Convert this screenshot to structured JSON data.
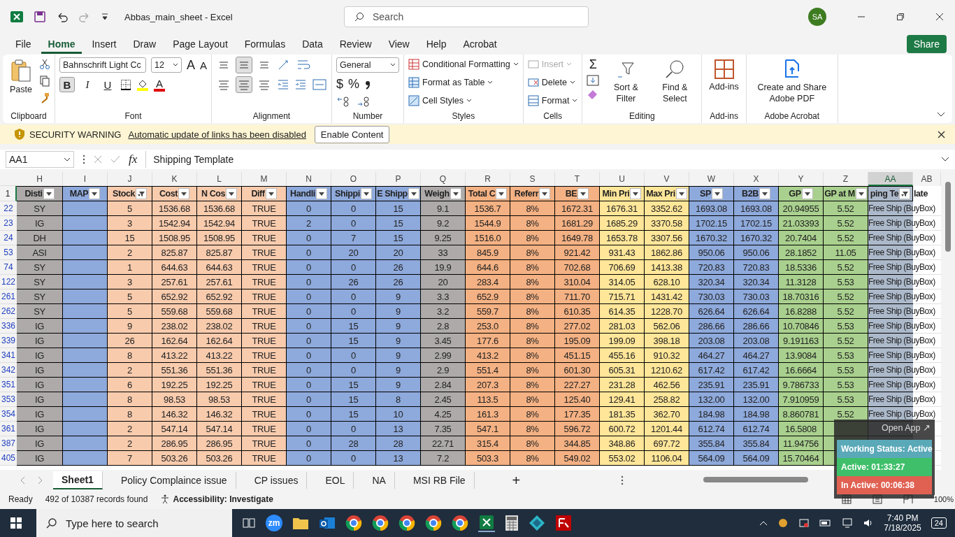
{
  "title_bar": {
    "title": "Abbas_main_sheet  -  Excel",
    "search_placeholder": "Search",
    "avatar": "SA"
  },
  "menu_tabs": [
    {
      "label": "File",
      "selected": false
    },
    {
      "label": "Home",
      "selected": true
    },
    {
      "label": "Insert",
      "selected": false
    },
    {
      "label": "Draw",
      "selected": false
    },
    {
      "label": "Page Layout",
      "selected": false
    },
    {
      "label": "Formulas",
      "selected": false
    },
    {
      "label": "Data",
      "selected": false
    },
    {
      "label": "Review",
      "selected": false
    },
    {
      "label": "View",
      "selected": false
    },
    {
      "label": "Help",
      "selected": false
    },
    {
      "label": "Acrobat",
      "selected": false
    }
  ],
  "share_button": "Share",
  "ribbon": {
    "paste": "Paste",
    "clipboard": "Clipboard",
    "font_name": "Bahnschrift Light Cc",
    "font_size": "12",
    "grow": "A",
    "shrink": "A",
    "bold": {
      "label": "B",
      "selected": true
    },
    "italic": {
      "label": "I",
      "selected": false
    },
    "underline": {
      "label": "U",
      "selected": false
    },
    "font_color_glyph": "A",
    "font": "Font",
    "align_center_selected": true,
    "alignment": "Alignment",
    "number_format": "General",
    "currency": "$",
    "percent": "%",
    "number": "Number",
    "conditional_formatting": "Conditional Formatting",
    "format_as_table": "Format as Table",
    "cell_styles": "Cell Styles",
    "styles": "Styles",
    "insert": {
      "label": "Insert",
      "disabled": true
    },
    "delete": "Delete",
    "format": "Format",
    "cells": "Cells",
    "sum": "Σ",
    "sort_filter": "Sort & Filter",
    "find_select": "Find & Select",
    "editing": "Editing",
    "addins_button": "Add-ins",
    "addins": "Add-ins",
    "create_pdf": "Create and Share Adobe PDF",
    "acrobat": "Adobe Acrobat"
  },
  "security_bar": {
    "title": "SECURITY WARNING",
    "message": "Automatic update of links has been disabled",
    "button": "Enable Content"
  },
  "formula_bar": {
    "name_box": "AA1",
    "fx": "fx",
    "formula": "Shipping Template"
  },
  "columns": [
    {
      "letter": "H",
      "header": "Disti",
      "color": "#aeaaaa",
      "filtered": false,
      "selected": false
    },
    {
      "letter": "I",
      "header": "MAP",
      "color": "#8ea9db",
      "filtered": false,
      "selected": false
    },
    {
      "letter": "J",
      "header": "Stock",
      "color": "#f8cbad",
      "filtered": true,
      "selected": false
    },
    {
      "letter": "K",
      "header": "Cost",
      "color": "#f8cbad",
      "filtered": false,
      "selected": false
    },
    {
      "letter": "L",
      "header": "N Cos",
      "color": "#f8cbad",
      "filtered": false,
      "selected": false
    },
    {
      "letter": "M",
      "header": "Diff",
      "color": "#f8cbad",
      "filtered": false,
      "selected": false
    },
    {
      "letter": "N",
      "header": "Handli",
      "color": "#8ea9db",
      "filtered": false,
      "selected": false
    },
    {
      "letter": "O",
      "header": "Shippi",
      "color": "#8ea9db",
      "filtered": false,
      "selected": false
    },
    {
      "letter": "P",
      "header": "E Shipp",
      "color": "#8ea9db",
      "filtered": false,
      "selected": false
    },
    {
      "letter": "Q",
      "header": "Weigh",
      "color": "#aeaaaa",
      "filtered": false,
      "selected": false
    },
    {
      "letter": "R",
      "header": "Total C",
      "color": "#f4b183",
      "filtered": false,
      "selected": false
    },
    {
      "letter": "S",
      "header": "Referr",
      "color": "#f4b183",
      "filtered": false,
      "selected": false
    },
    {
      "letter": "T",
      "header": "BE",
      "color": "#f4b183",
      "filtered": false,
      "selected": false
    },
    {
      "letter": "U",
      "header": "Min Pri",
      "color": "#ffe699",
      "filtered": false,
      "selected": false
    },
    {
      "letter": "V",
      "header": "Max Pri",
      "color": "#ffe699",
      "filtered": false,
      "selected": false
    },
    {
      "letter": "W",
      "header": "SP",
      "color": "#8ea9db",
      "filtered": false,
      "selected": false
    },
    {
      "letter": "X",
      "header": "B2B",
      "color": "#8ea9db",
      "filtered": false,
      "selected": false
    },
    {
      "letter": "Y",
      "header": "GP",
      "color": "#a9d08e",
      "filtered": false,
      "selected": false
    },
    {
      "letter": "Z",
      "header": "GP at M",
      "color": "#a9d08e",
      "filtered": false,
      "selected": false
    },
    {
      "letter": "AA",
      "header": "ping Te",
      "color": "#acb9ca",
      "filtered": true,
      "selected": true
    },
    {
      "letter": "AB",
      "header": "late",
      "color": "#ffffff",
      "selected": false
    }
  ],
  "header_row": "1",
  "rows": [
    {
      "row": "22",
      "cells": [
        "SY",
        null,
        "5",
        "1536.68",
        "1536.68",
        "TRUE",
        "0",
        "0",
        "15",
        "9.1",
        "1536.7",
        "8%",
        "1672.31",
        "1676.31",
        "3352.62",
        "1693.08",
        "1693.08",
        "20.94955",
        "5.52",
        "Free Ship (BuyBox)"
      ]
    },
    {
      "row": "23",
      "cells": [
        "IG",
        null,
        "3",
        "1542.94",
        "1542.94",
        "TRUE",
        "2",
        "0",
        "15",
        "9.2",
        "1544.9",
        "8%",
        "1681.29",
        "1685.29",
        "3370.58",
        "1702.15",
        "1702.15",
        "21.03393",
        "5.52",
        "Free Ship (BuyBox)"
      ]
    },
    {
      "row": "24",
      "cells": [
        "DH",
        null,
        "15",
        "1508.95",
        "1508.95",
        "TRUE",
        "0",
        "7",
        "15",
        "9.25",
        "1516.0",
        "8%",
        "1649.78",
        "1653.78",
        "3307.56",
        "1670.32",
        "1670.32",
        "20.7404",
        "5.52",
        "Free Ship (BuyBox)"
      ]
    },
    {
      "row": "53",
      "cells": [
        "ASI",
        null,
        "2",
        "825.87",
        "825.87",
        "TRUE",
        "0",
        "20",
        "20",
        "33",
        "845.9",
        "8%",
        "921.42",
        "931.43",
        "1862.86",
        "950.06",
        "950.06",
        "28.1852",
        "11.05",
        "Free Ship (BuyBox)"
      ]
    },
    {
      "row": "74",
      "cells": [
        "SY",
        null,
        "1",
        "644.63",
        "644.63",
        "TRUE",
        "0",
        "0",
        "26",
        "19.9",
        "644.6",
        "8%",
        "702.68",
        "706.69",
        "1413.38",
        "720.83",
        "720.83",
        "18.5336",
        "5.52",
        "Free Ship (BuyBox)"
      ]
    },
    {
      "row": "122",
      "cells": [
        "SY",
        null,
        "3",
        "257.61",
        "257.61",
        "TRUE",
        "0",
        "26",
        "26",
        "20",
        "283.4",
        "8%",
        "310.04",
        "314.05",
        "628.10",
        "320.34",
        "320.34",
        "11.3128",
        "5.53",
        "Free Ship (BuyBox)"
      ]
    },
    {
      "row": "261",
      "cells": [
        "SY",
        null,
        "5",
        "652.92",
        "652.92",
        "TRUE",
        "0",
        "0",
        "9",
        "3.3",
        "652.9",
        "8%",
        "711.70",
        "715.71",
        "1431.42",
        "730.03",
        "730.03",
        "18.70316",
        "5.52",
        "Free Ship (BuyBox)"
      ]
    },
    {
      "row": "262",
      "cells": [
        "SY",
        null,
        "5",
        "559.68",
        "559.68",
        "TRUE",
        "0",
        "0",
        "9",
        "3.2",
        "559.7",
        "8%",
        "610.35",
        "614.35",
        "1228.70",
        "626.64",
        "626.64",
        "16.8288",
        "5.52",
        "Free Ship (BuyBox)"
      ]
    },
    {
      "row": "336",
      "cells": [
        "IG",
        null,
        "9",
        "238.02",
        "238.02",
        "TRUE",
        "0",
        "15",
        "9",
        "2.8",
        "253.0",
        "8%",
        "277.02",
        "281.03",
        "562.06",
        "286.66",
        "286.66",
        "10.70846",
        "5.53",
        "Free Ship (BuyBox)"
      ]
    },
    {
      "row": "339",
      "cells": [
        "IG",
        null,
        "26",
        "162.64",
        "162.64",
        "TRUE",
        "0",
        "15",
        "9",
        "3.45",
        "177.6",
        "8%",
        "195.09",
        "199.09",
        "398.18",
        "203.08",
        "203.08",
        "9.191163",
        "5.52",
        "Free Ship (BuyBox)"
      ]
    },
    {
      "row": "341",
      "cells": [
        "IG",
        null,
        "8",
        "413.22",
        "413.22",
        "TRUE",
        "0",
        "0",
        "9",
        "2.99",
        "413.2",
        "8%",
        "451.15",
        "455.16",
        "910.32",
        "464.27",
        "464.27",
        "13.9084",
        "5.53",
        "Free Ship (BuyBox)"
      ]
    },
    {
      "row": "342",
      "cells": [
        "IG",
        null,
        "2",
        "551.36",
        "551.36",
        "TRUE",
        "0",
        "0",
        "9",
        "2.9",
        "551.4",
        "8%",
        "601.30",
        "605.31",
        "1210.62",
        "617.42",
        "617.42",
        "16.6664",
        "5.53",
        "Free Ship (BuyBox)"
      ]
    },
    {
      "row": "351",
      "cells": [
        "IG",
        null,
        "6",
        "192.25",
        "192.25",
        "TRUE",
        "0",
        "15",
        "9",
        "2.84",
        "207.3",
        "8%",
        "227.27",
        "231.28",
        "462.56",
        "235.91",
        "235.91",
        "9.786733",
        "5.53",
        "Free Ship (BuyBox)"
      ]
    },
    {
      "row": "353",
      "cells": [
        "IG",
        null,
        "8",
        "98.53",
        "98.53",
        "TRUE",
        "0",
        "15",
        "8",
        "2.45",
        "113.5",
        "8%",
        "125.40",
        "129.41",
        "258.82",
        "132.00",
        "132.00",
        "7.910959",
        "5.53",
        "Free Ship (BuyBox)"
      ]
    },
    {
      "row": "354",
      "cells": [
        "IG",
        null,
        "8",
        "146.32",
        "146.32",
        "TRUE",
        "0",
        "15",
        "10",
        "4.25",
        "161.3",
        "8%",
        "177.35",
        "181.35",
        "362.70",
        "184.98",
        "184.98",
        "8.860781",
        "5.52",
        "Free Ship (BuyBox)"
      ]
    },
    {
      "row": "361",
      "cells": [
        "IG",
        null,
        "2",
        "547.14",
        "547.14",
        "TRUE",
        "0",
        "0",
        "13",
        "7.35",
        "547.1",
        "8%",
        "596.72",
        "600.72",
        "1201.44",
        "612.74",
        "612.74",
        "16.5808",
        null,
        null
      ]
    },
    {
      "row": "387",
      "cells": [
        "IG",
        null,
        "2",
        "286.95",
        "286.95",
        "TRUE",
        "0",
        "28",
        "28",
        "22.71",
        "315.4",
        "8%",
        "344.85",
        "348.86",
        "697.72",
        "355.84",
        "355.84",
        "11.94756",
        null,
        null
      ]
    },
    {
      "row": "405",
      "cells": [
        "IG",
        null,
        "7",
        "503.26",
        "503.26",
        "TRUE",
        "0",
        "0",
        "13",
        "7.2",
        "503.3",
        "8%",
        "549.02",
        "553.02",
        "1106.04",
        "564.09",
        "564.09",
        "15.70464",
        null,
        null
      ]
    }
  ],
  "sheet_tabs": [
    {
      "label": "Sheet1",
      "selected": true
    },
    {
      "label": "Policy Complaince issue",
      "selected": false
    },
    {
      "label": "CP issues",
      "selected": false
    },
    {
      "label": "EOL",
      "selected": false
    },
    {
      "label": "NA",
      "selected": false
    },
    {
      "label": "MSI RB File",
      "selected": false
    }
  ],
  "add_sheet": "+",
  "status_bar": {
    "ready": "Ready",
    "records": "492 of 10387 records found",
    "accessibility": "Accessibility: Investigate",
    "zoom": "100%"
  },
  "tracker": {
    "open_app": "Open App ↗",
    "status": "Working Status: Active",
    "active": "Active: 01:33:27",
    "inactive": "In Active: 00:06:38"
  },
  "taskbar": {
    "search_placeholder": "Type here to search",
    "zoom_app": "zm",
    "time": "7:40 PM",
    "date": "7/18/2025",
    "notifications": "24"
  }
}
